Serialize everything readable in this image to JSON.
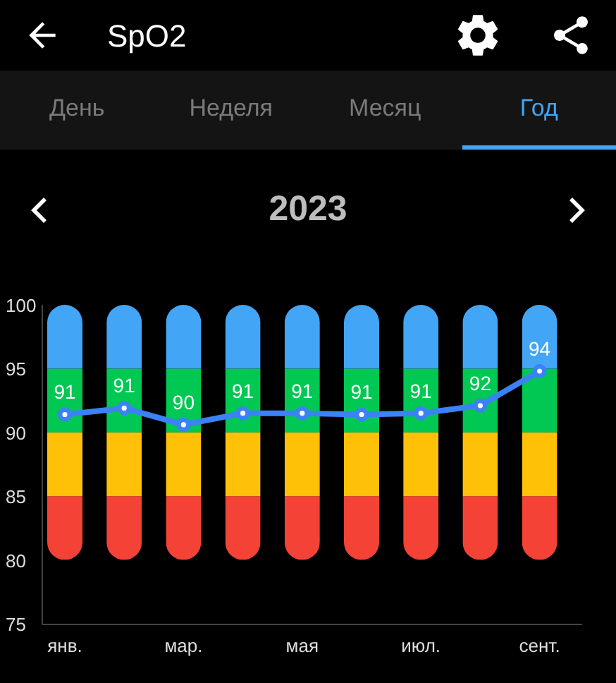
{
  "header": {
    "title": "SpO2"
  },
  "tabs": [
    {
      "label": "День",
      "selected": false
    },
    {
      "label": "Неделя",
      "selected": false
    },
    {
      "label": "Месяц",
      "selected": false
    },
    {
      "label": "Год",
      "selected": true
    }
  ],
  "period": {
    "label": "2023"
  },
  "chart_data": {
    "type": "line",
    "categories": [
      "янв.",
      null,
      "мар.",
      null,
      "мая",
      null,
      "июл.",
      null,
      "сент."
    ],
    "ylim": [
      75,
      100
    ],
    "yticks": [
      75,
      80,
      85,
      90,
      95,
      100
    ],
    "series": [
      {
        "color": "#3b82f6",
        "marker": "o",
        "values": [
          91.4,
          91.9,
          90.6,
          91.5,
          91.5,
          91.4,
          91.5,
          92.1,
          94.8
        ]
      }
    ],
    "value_labels": [
      "91",
      "91",
      "90",
      "91",
      "91",
      "91",
      "91",
      "92",
      "94"
    ]
  }
}
